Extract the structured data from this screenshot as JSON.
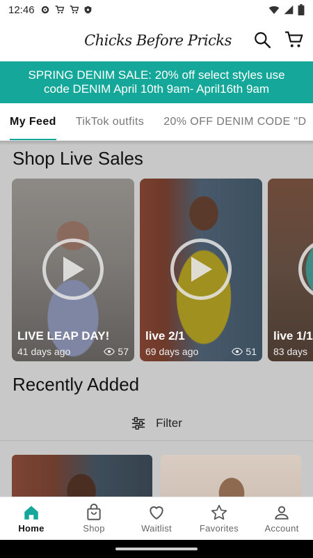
{
  "status_bar": {
    "time": "12:46",
    "icons": [
      "gear-icon",
      "cart-icon",
      "cart-icon",
      "shield-icon"
    ],
    "right_icons": [
      "wifi-icon",
      "signal-icon",
      "battery-icon"
    ]
  },
  "header": {
    "logo_text": "Chicks Before Pricks",
    "icons": [
      "search-icon",
      "cart-icon"
    ]
  },
  "promo": {
    "line1": "SPRING DENIM SALE: 20% off select styles use",
    "line2": "code DENIM April 10th 9am- April16th 9am",
    "bg_color": "#15a89a"
  },
  "tabs": [
    {
      "label": "My Feed",
      "active": true
    },
    {
      "label": "TikTok outfits",
      "active": false
    },
    {
      "label": "20% OFF DENIM CODE \"D",
      "active": false
    }
  ],
  "live_sales": {
    "title": "Shop Live Sales",
    "items": [
      {
        "title": "LIVE LEAP DAY!",
        "age": "41 days ago",
        "views": "57"
      },
      {
        "title": "live 2/1",
        "age": "69 days ago",
        "views": "51"
      },
      {
        "title": "live 1/1",
        "age": "83 days",
        "views": ""
      }
    ]
  },
  "recently_added": {
    "title": "Recently Added",
    "filter_label": "Filter"
  },
  "bottom_nav": [
    {
      "label": "Home",
      "icon": "home-icon",
      "active": true
    },
    {
      "label": "Shop",
      "icon": "shopping-bag-icon",
      "active": false
    },
    {
      "label": "Waitlist",
      "icon": "heart-icon",
      "active": false
    },
    {
      "label": "Favorites",
      "icon": "star-icon",
      "active": false
    },
    {
      "label": "Account",
      "icon": "person-icon",
      "active": false
    }
  ],
  "colors": {
    "accent": "#15a89a",
    "content_bg": "#c8c8c8",
    "active_tab": "#111111"
  }
}
